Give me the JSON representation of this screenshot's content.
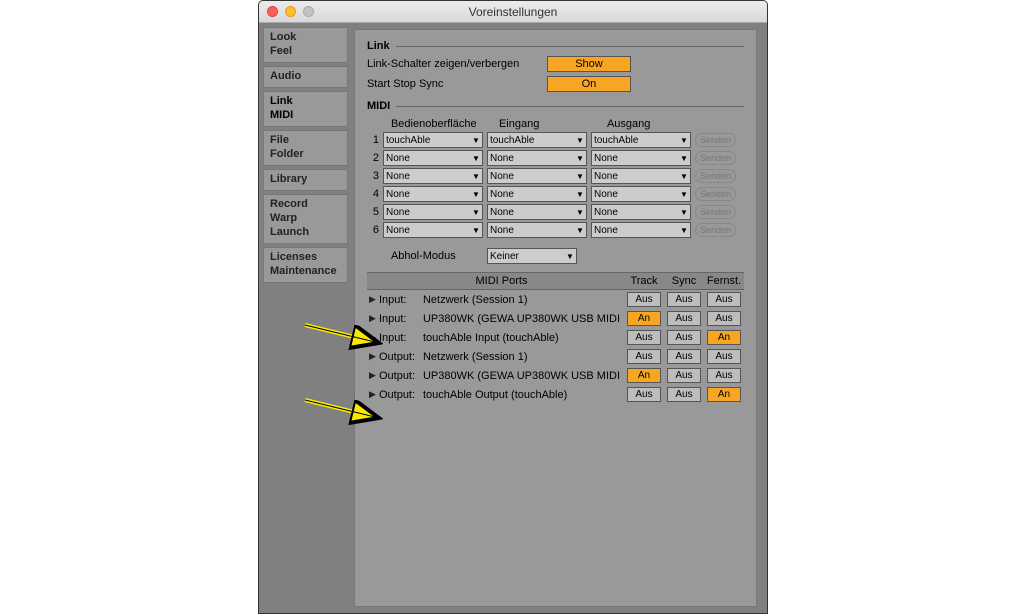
{
  "window": {
    "title": "Voreinstellungen"
  },
  "sidebar": [
    {
      "lines": [
        "Look",
        "Feel"
      ]
    },
    {
      "lines": [
        "Audio"
      ]
    },
    {
      "lines": [
        "Link",
        "MIDI"
      ],
      "active": true
    },
    {
      "lines": [
        "File",
        "Folder"
      ]
    },
    {
      "lines": [
        "Library"
      ]
    },
    {
      "lines": [
        "Record",
        "Warp",
        "Launch"
      ]
    },
    {
      "lines": [
        "Licenses",
        "Maintenance"
      ]
    }
  ],
  "link": {
    "title": "Link",
    "show_label": "Link-Schalter zeigen/verbergen",
    "show_value": "Show",
    "sync_label": "Start Stop Sync",
    "sync_value": "On"
  },
  "midi": {
    "title": "MIDI",
    "col1": "Bedienoberfläche",
    "col2": "Eingang",
    "col3": "Ausgang",
    "senden_label": "Senden",
    "slots": [
      {
        "num": "1",
        "surface": "touchAble",
        "input": "touchAble",
        "output": "touchAble"
      },
      {
        "num": "2",
        "surface": "None",
        "input": "None",
        "output": "None"
      },
      {
        "num": "3",
        "surface": "None",
        "input": "None",
        "output": "None"
      },
      {
        "num": "4",
        "surface": "None",
        "input": "None",
        "output": "None"
      },
      {
        "num": "5",
        "surface": "None",
        "input": "None",
        "output": "None"
      },
      {
        "num": "6",
        "surface": "None",
        "input": "None",
        "output": "None"
      }
    ],
    "pickup_label": "Abhol-Modus",
    "pickup_value": "Keiner"
  },
  "ports": {
    "header_title": "MIDI Ports",
    "col_track": "Track",
    "col_sync": "Sync",
    "col_remote": "Fernst.",
    "on_label": "An",
    "off_label": "Aus",
    "rows": [
      {
        "io": "Input:",
        "name": "Netzwerk (Session 1)",
        "track": false,
        "sync": false,
        "remote": false
      },
      {
        "io": "Input:",
        "name": "UP380WK (GEWA UP380WK USB MIDI",
        "track": true,
        "sync": false,
        "remote": false
      },
      {
        "io": "Input:",
        "name": "touchAble Input (touchAble)",
        "track": false,
        "sync": false,
        "remote": true
      },
      {
        "io": "Output:",
        "name": "Netzwerk (Session 1)",
        "track": false,
        "sync": false,
        "remote": false
      },
      {
        "io": "Output:",
        "name": "UP380WK (GEWA UP380WK USB MIDI",
        "track": true,
        "sync": false,
        "remote": false
      },
      {
        "io": "Output:",
        "name": "touchAble Output (touchAble)",
        "track": false,
        "sync": false,
        "remote": true
      }
    ]
  }
}
